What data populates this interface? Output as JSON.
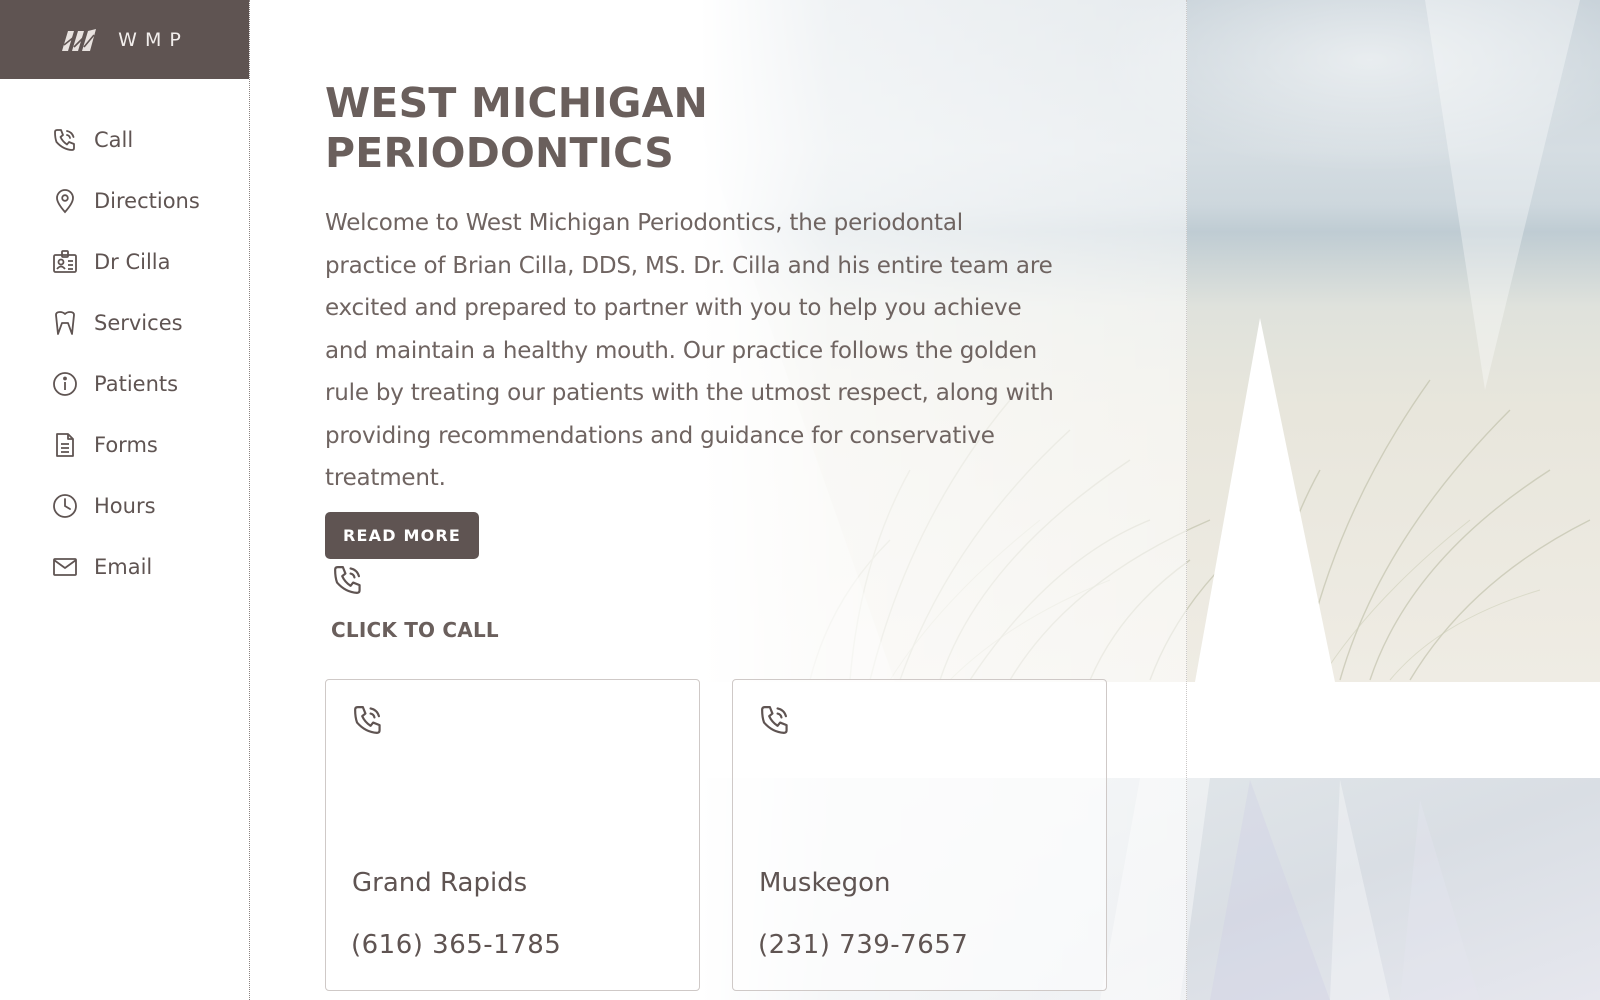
{
  "brand": {
    "logo_text": "WMP",
    "color": "#5f5452"
  },
  "sidebar": {
    "items": [
      {
        "label": "Call",
        "icon": "phone-icon"
      },
      {
        "label": "Directions",
        "icon": "map-pin-icon"
      },
      {
        "label": "Dr Cilla",
        "icon": "id-badge-icon"
      },
      {
        "label": "Services",
        "icon": "tooth-icon"
      },
      {
        "label": "Patients",
        "icon": "info-icon"
      },
      {
        "label": "Forms",
        "icon": "document-icon"
      },
      {
        "label": "Hours",
        "icon": "clock-icon"
      },
      {
        "label": "Email",
        "icon": "envelope-icon"
      }
    ]
  },
  "main": {
    "title": "WEST MICHIGAN PERIODONTICS",
    "intro": "Welcome to West Michigan Periodontics, the periodontal practice of Brian Cilla, DDS, MS. Dr. Cilla and his entire team are excited and prepared to partner with you to help you achieve and maintain a healthy mouth. Our practice follows the golden rule by treating our patients with the utmost respect, along with providing recommendations and guidance for conservative treatment.",
    "read_more_label": "READ MORE",
    "call_cta": "CLICK TO CALL",
    "locations": [
      {
        "city": "Grand Rapids",
        "phone": "(616) 365-1785"
      },
      {
        "city": "Muskegon",
        "phone": "(231) 739-7657"
      }
    ]
  }
}
